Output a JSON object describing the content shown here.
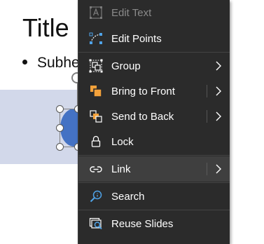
{
  "slide": {
    "title": "Title",
    "subheading": "Subhe"
  },
  "colors": {
    "menu_background": "#2b2b2b",
    "menu_hover": "#3f3f3f",
    "menu_text": "#ffffff",
    "menu_disabled_text": "#8a8a8a",
    "shape_fill": "#4472c4",
    "slide_band": "#d2d8ea",
    "icon_blue": "#4fa3e8",
    "icon_orange": "#f4a23b"
  },
  "context_menu": {
    "items": [
      {
        "label": "Edit Text",
        "icon": "edit-text-icon",
        "disabled": true,
        "submenu": false
      },
      {
        "label": "Edit Points",
        "icon": "edit-points-icon",
        "disabled": false,
        "submenu": false
      },
      {
        "label": "Group",
        "icon": "group-icon",
        "disabled": false,
        "submenu": true
      },
      {
        "label": "Bring to Front",
        "icon": "bring-to-front-icon",
        "disabled": false,
        "submenu": true
      },
      {
        "label": "Send to Back",
        "icon": "send-to-back-icon",
        "disabled": false,
        "submenu": true
      },
      {
        "label": "Lock",
        "icon": "lock-icon",
        "disabled": false,
        "submenu": false
      },
      {
        "label": "Link",
        "icon": "link-icon",
        "disabled": false,
        "submenu": true,
        "highlighted": true
      },
      {
        "label": "Search",
        "icon": "search-icon",
        "disabled": false,
        "submenu": false
      },
      {
        "label": "Reuse Slides",
        "icon": "reuse-slides-icon",
        "disabled": false,
        "submenu": false
      }
    ]
  }
}
